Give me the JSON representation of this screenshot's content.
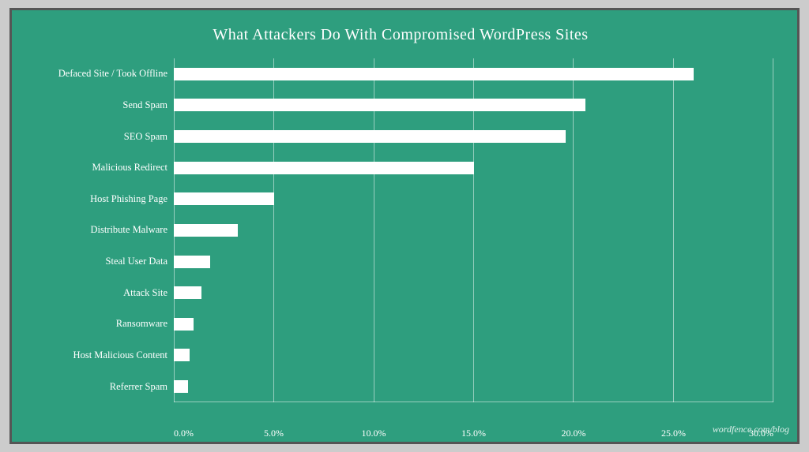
{
  "chart": {
    "title": "What Attackers Do With Compromised WordPress Sites",
    "watermark": "wordfence.com/blog",
    "bars": [
      {
        "label": "Defaced Site / Took Offline",
        "value": 26.0,
        "pct": 86.7
      },
      {
        "label": "Send Spam",
        "value": 20.6,
        "pct": 68.7
      },
      {
        "label": "SEO Spam",
        "value": 19.6,
        "pct": 65.3
      },
      {
        "label": "Malicious Redirect",
        "value": 15.0,
        "pct": 50.0
      },
      {
        "label": "Host Phishing Page",
        "value": 5.0,
        "pct": 16.7
      },
      {
        "label": "Distribute Malware",
        "value": 3.2,
        "pct": 10.7
      },
      {
        "label": "Steal User Data",
        "value": 1.8,
        "pct": 6.0
      },
      {
        "label": "Attack Site",
        "value": 1.4,
        "pct": 4.7
      },
      {
        "label": "Ransomware",
        "value": 1.0,
        "pct": 3.3
      },
      {
        "label": "Host Malicious Content",
        "value": 0.8,
        "pct": 2.7
      },
      {
        "label": "Referrer Spam",
        "value": 0.7,
        "pct": 2.3
      }
    ],
    "x_axis": {
      "labels": [
        "0.0%",
        "5.0%",
        "10.0%",
        "15.0%",
        "20.0%",
        "25.0%",
        "30.0%"
      ],
      "max": 30
    }
  }
}
